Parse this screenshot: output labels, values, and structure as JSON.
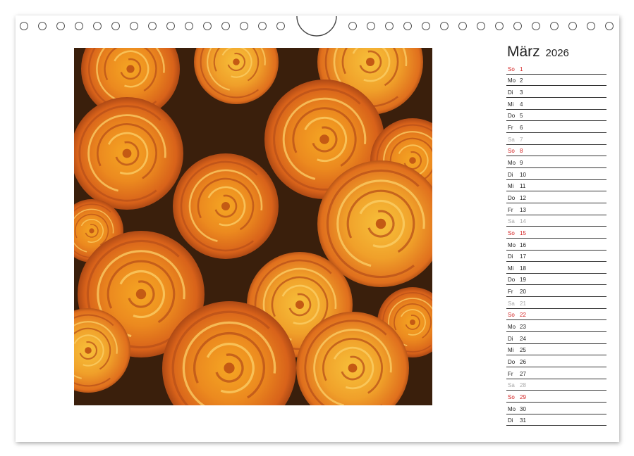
{
  "calendar": {
    "month": "März",
    "year": "2026",
    "days": [
      {
        "wd": "So",
        "num": "1",
        "type": "sun"
      },
      {
        "wd": "Mo",
        "num": "2",
        "type": "norm"
      },
      {
        "wd": "Di",
        "num": "3",
        "type": "norm"
      },
      {
        "wd": "Mi",
        "num": "4",
        "type": "norm"
      },
      {
        "wd": "Do",
        "num": "5",
        "type": "norm"
      },
      {
        "wd": "Fr",
        "num": "6",
        "type": "norm"
      },
      {
        "wd": "Sa",
        "num": "7",
        "type": "sat"
      },
      {
        "wd": "So",
        "num": "8",
        "type": "sun"
      },
      {
        "wd": "Mo",
        "num": "9",
        "type": "norm"
      },
      {
        "wd": "Di",
        "num": "10",
        "type": "norm"
      },
      {
        "wd": "Mi",
        "num": "11",
        "type": "norm"
      },
      {
        "wd": "Do",
        "num": "12",
        "type": "norm"
      },
      {
        "wd": "Fr",
        "num": "13",
        "type": "norm"
      },
      {
        "wd": "Sa",
        "num": "14",
        "type": "sat"
      },
      {
        "wd": "So",
        "num": "15",
        "type": "sun"
      },
      {
        "wd": "Mo",
        "num": "16",
        "type": "norm"
      },
      {
        "wd": "Di",
        "num": "17",
        "type": "norm"
      },
      {
        "wd": "Mi",
        "num": "18",
        "type": "norm"
      },
      {
        "wd": "Do",
        "num": "19",
        "type": "norm"
      },
      {
        "wd": "Fr",
        "num": "20",
        "type": "norm"
      },
      {
        "wd": "Sa",
        "num": "21",
        "type": "sat"
      },
      {
        "wd": "So",
        "num": "22",
        "type": "sun"
      },
      {
        "wd": "Mo",
        "num": "23",
        "type": "norm"
      },
      {
        "wd": "Di",
        "num": "24",
        "type": "norm"
      },
      {
        "wd": "Mi",
        "num": "25",
        "type": "norm"
      },
      {
        "wd": "Do",
        "num": "26",
        "type": "norm"
      },
      {
        "wd": "Fr",
        "num": "27",
        "type": "norm"
      },
      {
        "wd": "Sa",
        "num": "28",
        "type": "sat"
      },
      {
        "wd": "So",
        "num": "29",
        "type": "sun"
      },
      {
        "wd": "Mo",
        "num": "30",
        "type": "norm"
      },
      {
        "wd": "Di",
        "num": "31",
        "type": "norm"
      }
    ]
  },
  "colors": {
    "sunday": "#d21e1e",
    "saturday": "#a8a8a8",
    "weekday": "#222222",
    "rose_orange": "#e8761e",
    "rose_yellow": "#f2b02a"
  },
  "photo": {
    "subject": "orange-roses-photo"
  }
}
